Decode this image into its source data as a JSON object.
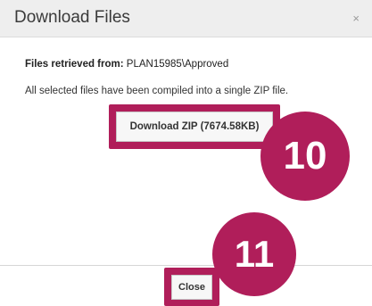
{
  "dialog": {
    "title": "Download Files",
    "close_icon": "×"
  },
  "content": {
    "source_label": "Files retrieved from:",
    "source_path": "PLAN15985\\Approved",
    "message": "All selected files have been compiled into a single ZIP file.",
    "download_label": "Download ZIP (7674.58KB)"
  },
  "footer": {
    "close_label": "Close"
  },
  "callouts": {
    "step_10": "10",
    "step_11": "11"
  },
  "colors": {
    "highlight": "#b01e5a",
    "titlebar": "#eeeeee"
  },
  "icons": {
    "close": "close-icon"
  }
}
